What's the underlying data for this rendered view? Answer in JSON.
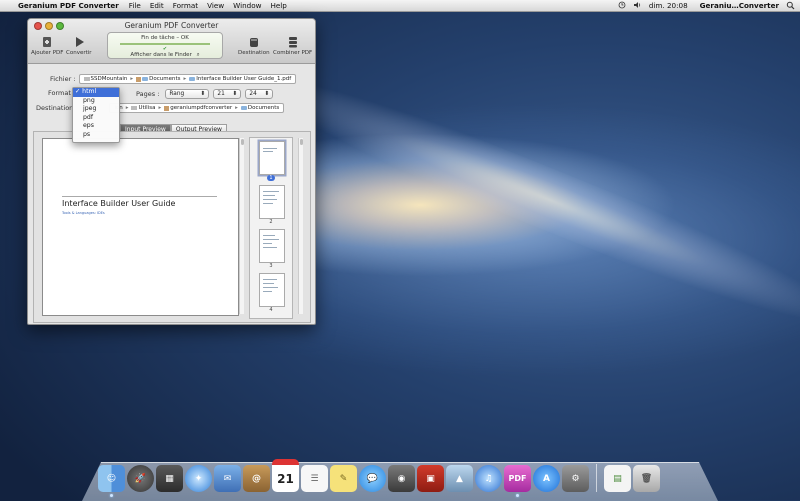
{
  "menubar": {
    "apple_glyph": "",
    "app_name": "Geranium PDF Converter",
    "menus": [
      "File",
      "Edit",
      "Format",
      "View",
      "Window",
      "Help"
    ],
    "clock": "dim. 20:08",
    "user": "Geraniu…Converter"
  },
  "window": {
    "title": "Geranium PDF Converter",
    "toolbar": {
      "add_pdf": "Ajouter PDF",
      "convert": "Convertir",
      "destination": "Destination",
      "combine": "Combiner PDF"
    },
    "status": {
      "line1": "Fin de tâche – OK",
      "check": "✔",
      "show_in_finder": "Afficher dans le Finder"
    },
    "file_row": {
      "label": "Fichier :",
      "path": [
        "SSDMountain",
        "▸",
        "Documents",
        "Interface Builder User Guide_1.pdf"
      ]
    },
    "format_row": {
      "label": "Format",
      "pages_label": "Pages :",
      "range_value": "Rang",
      "from_value": "21",
      "to_value": "24"
    },
    "destination_row": {
      "label": "Destination",
      "path": [
        "ion",
        "Utilisa",
        "geraniumpdfconverter",
        "Documents"
      ]
    },
    "format_menu": {
      "checkmark": "✓",
      "options": [
        "html",
        "png",
        "jpeg",
        "pdf",
        "eps",
        "ps"
      ],
      "selected": "html"
    },
    "tabs": [
      "Input Preview",
      "Output Preview"
    ],
    "preview": {
      "doc_title": "Interface Builder User Guide",
      "doc_sub": "Tools & Languages: IDEs"
    },
    "thumbnails": [
      "1",
      "2",
      "3",
      "4"
    ]
  },
  "dock": {
    "items": [
      "Finder",
      "Launchpad",
      "Mission Control",
      "Safari",
      "Mail",
      "Contacts",
      "Calendar",
      "Reminders",
      "Notes",
      "Messages",
      "FaceTime",
      "Photo Booth",
      "iPhoto",
      "iTunes",
      "Geranium PDF",
      "App Store",
      "System Preferences",
      "Documents",
      "Trash"
    ],
    "calendar_day": "21",
    "pdf_label": "PDF"
  }
}
